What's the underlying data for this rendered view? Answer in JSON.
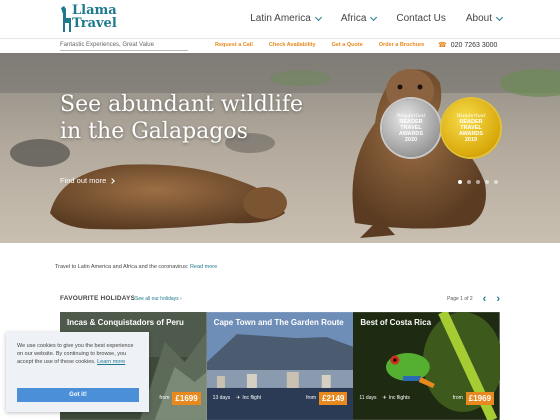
{
  "header": {
    "logo_text_line1": "Llama",
    "logo_text_line2": "Travel",
    "nav": [
      {
        "label": "Latin America",
        "dropdown": true
      },
      {
        "label": "Africa",
        "dropdown": true
      },
      {
        "label": "Contact Us",
        "dropdown": false
      },
      {
        "label": "About",
        "dropdown": true
      }
    ]
  },
  "subbar": {
    "tagline": "Fantastic Experiences, Great Value",
    "quicklinks": [
      "Request a Call",
      "Check Availability",
      "Get a Quote",
      "Order a Brochure"
    ],
    "phone_icon": "phone-icon",
    "phone": "020 7263 3000"
  },
  "hero": {
    "title": "See abundant wildlife in the Galapagos",
    "link": "Find out more",
    "badges": [
      {
        "top": "Wanderlust",
        "l1": "READER",
        "l2": "TRAVEL",
        "l3": "AWARDS",
        "year": "2020",
        "color": "silver"
      },
      {
        "top": "Wanderlust",
        "l1": "READER",
        "l2": "TRAVEL",
        "l3": "AWARDS",
        "year": "2019",
        "color": "gold"
      }
    ],
    "slides_count": 5,
    "active_slide": 1
  },
  "notice": {
    "text": "Travel to Latin America and Africa and the coronavirus:",
    "link": "Read more"
  },
  "favourites": {
    "title": "FAVOURITE HOLIDAYS",
    "see_all": "See all our holidays ›",
    "page": "Page 1 of 2",
    "cards": [
      {
        "title": "Incas & Conquistadors of Peru",
        "days": "",
        "flights": "",
        "from": "from",
        "price": "£1699"
      },
      {
        "title": "Cape Town and The Garden Route",
        "days": "13 days",
        "flights": "Inc flight",
        "from": "from",
        "price": "£2149"
      },
      {
        "title": "Best of Costa Rica",
        "days": "11 days",
        "flights": "Inc flights",
        "from": "from",
        "price": "£1969"
      }
    ]
  },
  "cookie": {
    "text": "We use cookies to give you the best experience on our website. By continuing to browse, you accept the use of these cookies.",
    "link": "Learn more",
    "button": "Got it!"
  },
  "colors": {
    "brand": "#1d7a8c",
    "accent": "#e8891f",
    "cookie_button": "#4a8fd8"
  }
}
